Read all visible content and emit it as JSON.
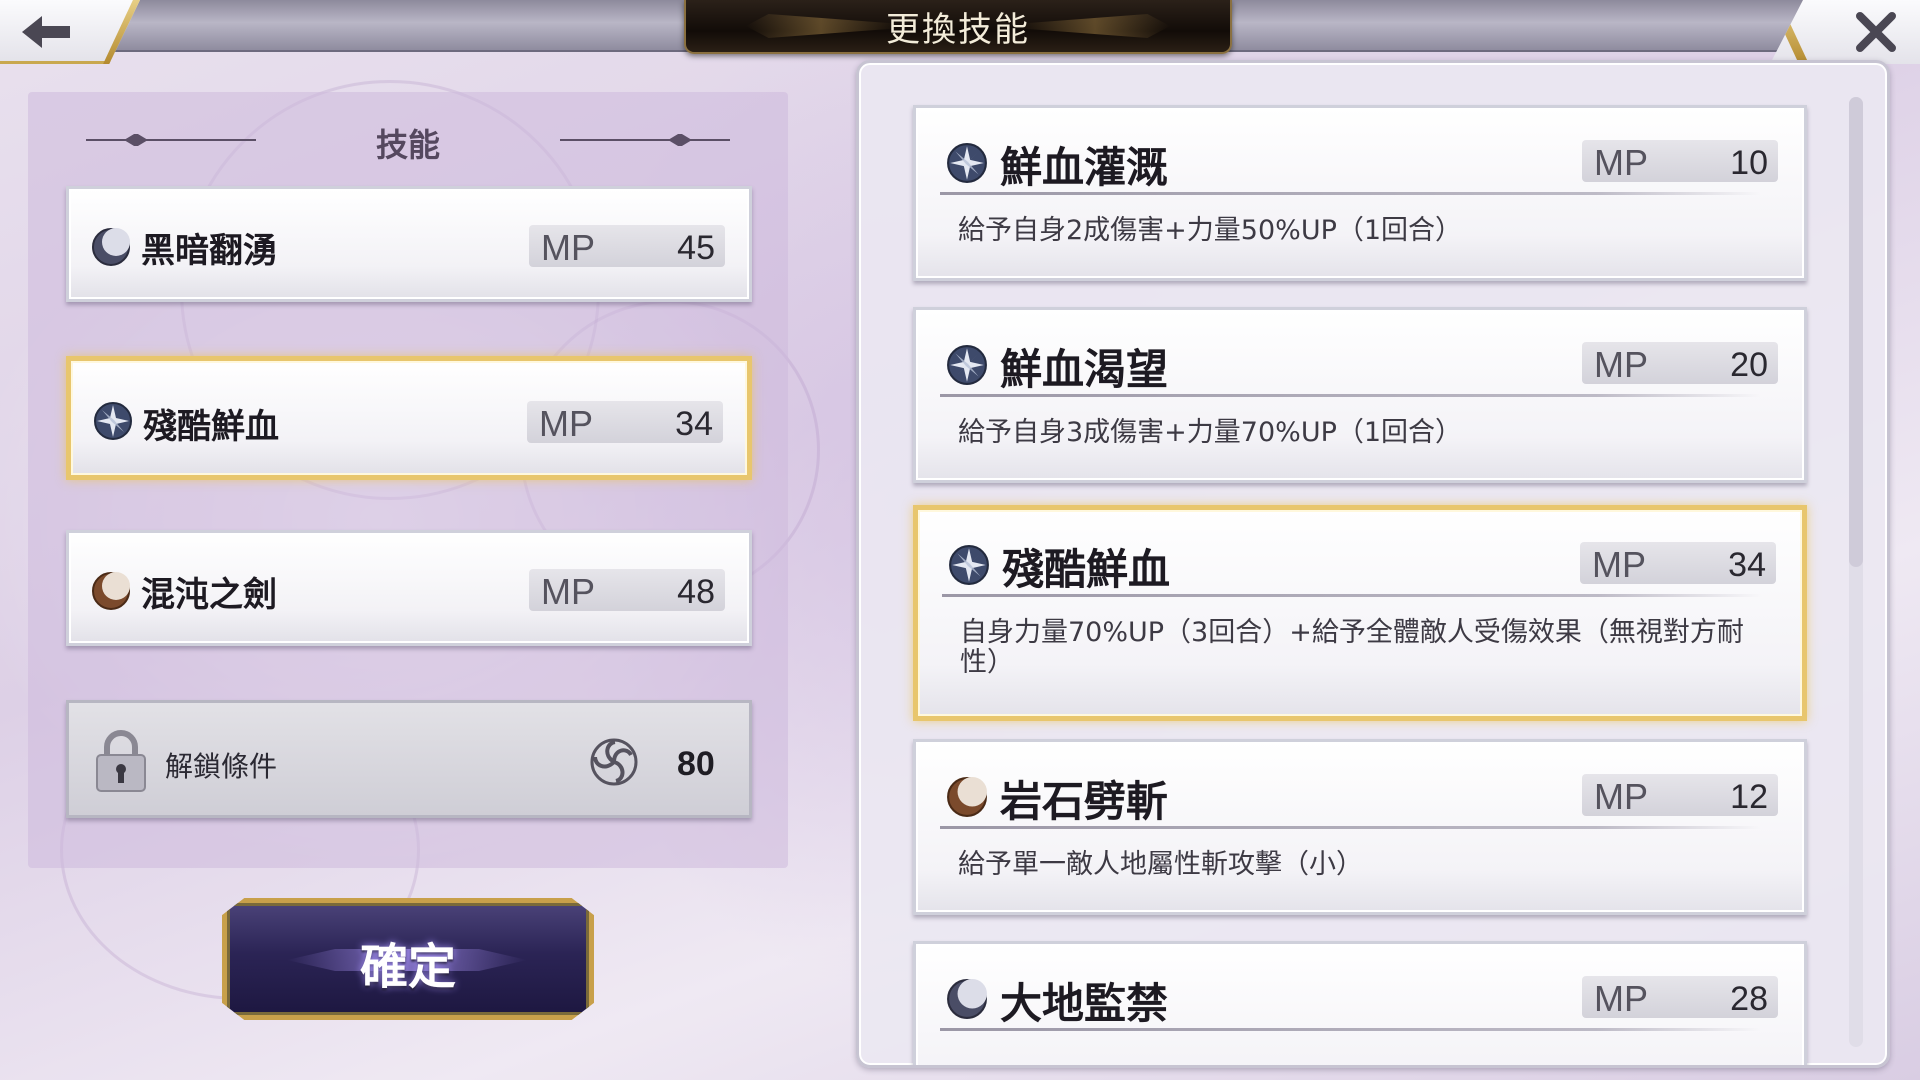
{
  "header": {
    "title": "更換技能",
    "back_icon": "left-arrow-icon",
    "close_icon": "close-x-icon"
  },
  "equipped": {
    "title": "技能",
    "slots": [
      {
        "name": "黑暗翻湧",
        "mp_label": "MP",
        "mp": "45",
        "icon": "dark-moon-icon",
        "selected": false
      },
      {
        "name": "殘酷鮮血",
        "mp_label": "MP",
        "mp": "34",
        "icon": "compass-star-icon",
        "selected": true
      },
      {
        "name": "混沌之劍",
        "mp_label": "MP",
        "mp": "48",
        "icon": "earth-moon-icon",
        "selected": false
      }
    ],
    "locked_slot": {
      "label": "解鎖條件",
      "cost": "80",
      "icon": "lock-icon",
      "currency_icon": "swirl-token-icon"
    }
  },
  "confirm_label": "確定",
  "skills": [
    {
      "name": "鮮血灌溉",
      "mp_label": "MP",
      "mp": "10",
      "icon": "compass-star-icon",
      "desc": "給予自身2成傷害+力量50%UP（1回合）",
      "selected": false
    },
    {
      "name": "鮮血渴望",
      "mp_label": "MP",
      "mp": "20",
      "icon": "compass-star-icon",
      "desc": "給予自身3成傷害+力量70%UP（1回合）",
      "selected": false
    },
    {
      "name": "殘酷鮮血",
      "mp_label": "MP",
      "mp": "34",
      "icon": "compass-star-icon",
      "desc": "自身力量70%UP（3回合）+給予全體敵人受傷效果（無視對方耐性）",
      "selected": true
    },
    {
      "name": "岩石劈斬",
      "mp_label": "MP",
      "mp": "12",
      "icon": "earth-moon-icon",
      "desc": "給予單一敵人地屬性斬攻擊（小）",
      "selected": false
    },
    {
      "name": "大地監禁",
      "mp_label": "MP",
      "mp": "28",
      "icon": "dark-moon-icon",
      "desc": "",
      "selected": false
    }
  ],
  "colors": {
    "selected_border": "#e8c66d",
    "title_plate": "#120c08",
    "confirm_button": "#2b2455"
  }
}
